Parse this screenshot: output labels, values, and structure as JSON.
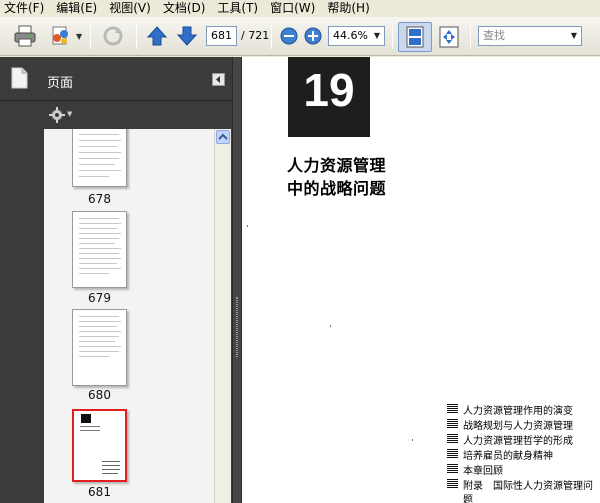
{
  "menu": [
    {
      "label": "文件(F)"
    },
    {
      "label": "编辑(E)"
    },
    {
      "label": "视图(V)"
    },
    {
      "label": "文档(D)"
    },
    {
      "label": "工具(T)"
    },
    {
      "label": "窗口(W)"
    },
    {
      "label": "帮助(H)"
    }
  ],
  "toolbar": {
    "page_current": "681",
    "page_total": "/ 721",
    "zoom": "44.6%",
    "search_placeholder": "查找",
    "icons": [
      "printer-icon",
      "share-icon",
      "sync-icon",
      "arrow-up-icon",
      "arrow-down-icon",
      "zoom-out-icon",
      "zoom-in-icon",
      "fit-page-icon",
      "full-screen-icon"
    ]
  },
  "panel": {
    "title": "页面",
    "thumbnails": [
      {
        "label": "678",
        "selected": false
      },
      {
        "label": "679",
        "selected": false
      },
      {
        "label": "680",
        "selected": false
      },
      {
        "label": "681",
        "selected": true
      }
    ]
  },
  "document": {
    "chapter_number": "19",
    "title_line1": "人力资源管理",
    "title_line2": "中的战略问题",
    "contents": [
      "人力资源管理作用的演变",
      "战略规划与人力资源管理",
      "人力资源管理哲学的形成",
      "培养雇员的献身精神",
      "本章回顾",
      "附录　国际性人力资源管理问",
      "题"
    ]
  },
  "colors": {
    "panel_bg": "#3b3b3b",
    "selected_thumb_border": "#e02020",
    "accent_blue": "#2f6fc8"
  }
}
